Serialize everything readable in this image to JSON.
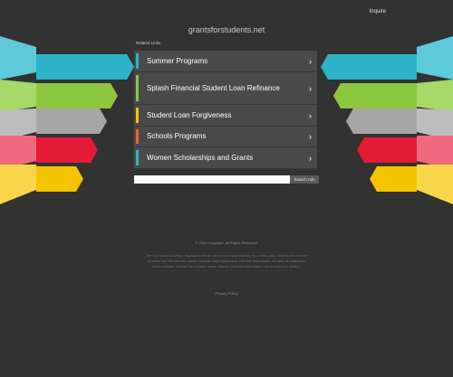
{
  "header": {
    "top_link": "Inquire",
    "domain": "grantsforstudents.net"
  },
  "related": {
    "label": "Related Links",
    "items": [
      {
        "label": "Summer Programs",
        "color": "#2ab3c9"
      },
      {
        "label": "Splash Financial Student Loan Refinance",
        "color": "#8dc63f"
      },
      {
        "label": "Student Loan Forgiveness",
        "color": "#f5c400"
      },
      {
        "label": "Schools Programs",
        "color": "#e8682a"
      },
      {
        "label": "Women Scholarships and Grants",
        "color": "#2ab3c9"
      }
    ]
  },
  "search": {
    "placeholder": "",
    "button": "Search Ads"
  },
  "footer": {
    "copyright": "© 2024 Copyright. All Rights Reserved.",
    "disclaimer": "The Sponsored Listings displayed above are served automatically by a third party. Neither the service provider nor the domain owner maintain any relationship with the advertisers. In case of trademark issues please contact the domain owner directly (contact information can be found in whois).",
    "privacy": "Privacy Policy"
  },
  "ribbon_colors": [
    "#2ab3c9",
    "#8dc63f",
    "#a6a6a6",
    "#e31b37",
    "#f5c400"
  ]
}
